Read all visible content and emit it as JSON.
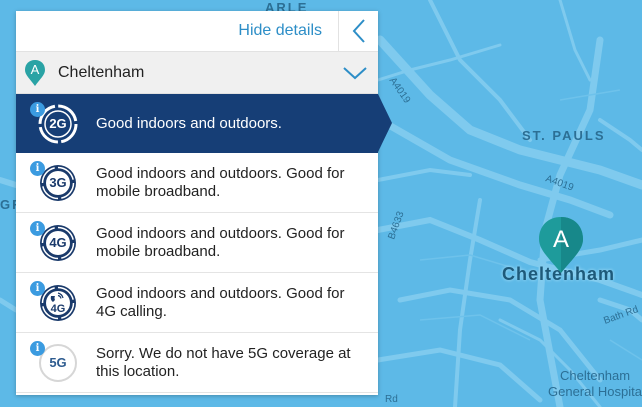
{
  "map": {
    "labels": {
      "arle": "ARLE",
      "st_pauls": "ST. PAULS",
      "gr": "GR",
      "city": "Cheltenham",
      "hospital_line1": "Cheltenham",
      "hospital_line2": "General Hospital"
    },
    "roads": {
      "a4019_top": "A4019",
      "a4019_mid": "A4019",
      "b4633": "B4633",
      "bath_rd": "Bath Rd",
      "rd": "Rd"
    },
    "pin_letter": "A",
    "pin_color": "#1e9b9b"
  },
  "panel": {
    "hide_details": "Hide details",
    "location": {
      "pin_letter": "A",
      "name": "Cheltenham"
    },
    "rows": [
      {
        "id": "2g",
        "badge": "2G",
        "description": "Good indoors and outdoors.",
        "selected": true
      },
      {
        "id": "3g",
        "badge": "3G",
        "description": "Good indoors and outdoors. Good for mobile broadband.",
        "selected": false
      },
      {
        "id": "4g",
        "badge": "4G",
        "description": "Good indoors and outdoors. Good for mobile broadband.",
        "selected": false
      },
      {
        "id": "4g-calling",
        "badge": "4G",
        "description": "Good indoors and outdoors. Good for 4G calling.",
        "selected": false
      },
      {
        "id": "5g",
        "badge": "5G",
        "description": "Sorry. We do not have 5G coverage at this location.",
        "selected": false
      }
    ],
    "info_glyph": "i"
  },
  "colors": {
    "accent": "#2d8ec7",
    "selected_bg": "#163e76",
    "badge_dark": "#1a3a6b",
    "info_blue": "#3b9be0",
    "map_bg": "#5db9e7"
  }
}
